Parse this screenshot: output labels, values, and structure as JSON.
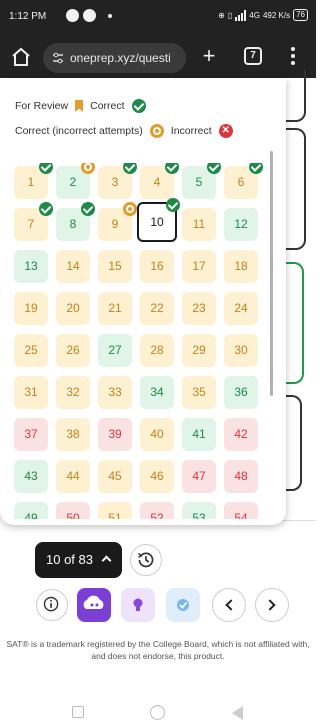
{
  "status_bar": {
    "time": "1:12 PM",
    "network": "4G",
    "speed": "492 K/s",
    "battery": "76"
  },
  "browser": {
    "url": "oneprep.xyz/questi",
    "tab_count": "7"
  },
  "legend": {
    "for_review": "For Review",
    "correct": "Correct",
    "correct_incorrect_attempts": "Correct (incorrect attempts)",
    "incorrect": "Incorrect"
  },
  "colors": {
    "review": "#c2831b",
    "correct": "#1e8a47",
    "incorrect": "#d9363e",
    "ai_button": "#7c3fd6"
  },
  "questions": [
    {
      "n": "1",
      "status": "review",
      "mark": "correct"
    },
    {
      "n": "2",
      "status": "correct",
      "mark": "correct_attempts"
    },
    {
      "n": "3",
      "status": "review",
      "mark": "correct"
    },
    {
      "n": "4",
      "status": "review",
      "mark": "correct"
    },
    {
      "n": "5",
      "status": "correct",
      "mark": "correct"
    },
    {
      "n": "6",
      "status": "review",
      "mark": "correct"
    },
    {
      "n": "7",
      "status": "review",
      "mark": "correct"
    },
    {
      "n": "8",
      "status": "correct",
      "mark": "correct"
    },
    {
      "n": "9",
      "status": "review",
      "mark": "correct_attempts"
    },
    {
      "n": "10",
      "status": "current",
      "mark": "correct"
    },
    {
      "n": "11",
      "status": "review",
      "mark": ""
    },
    {
      "n": "12",
      "status": "correct",
      "mark": ""
    },
    {
      "n": "13",
      "status": "correct",
      "mark": ""
    },
    {
      "n": "14",
      "status": "review",
      "mark": ""
    },
    {
      "n": "15",
      "status": "review",
      "mark": ""
    },
    {
      "n": "16",
      "status": "review",
      "mark": ""
    },
    {
      "n": "17",
      "status": "review",
      "mark": ""
    },
    {
      "n": "18",
      "status": "review",
      "mark": ""
    },
    {
      "n": "19",
      "status": "review",
      "mark": ""
    },
    {
      "n": "20",
      "status": "review",
      "mark": ""
    },
    {
      "n": "21",
      "status": "review",
      "mark": ""
    },
    {
      "n": "22",
      "status": "review",
      "mark": ""
    },
    {
      "n": "23",
      "status": "review",
      "mark": ""
    },
    {
      "n": "24",
      "status": "review",
      "mark": ""
    },
    {
      "n": "25",
      "status": "review",
      "mark": ""
    },
    {
      "n": "26",
      "status": "review",
      "mark": ""
    },
    {
      "n": "27",
      "status": "correct",
      "mark": ""
    },
    {
      "n": "28",
      "status": "review",
      "mark": ""
    },
    {
      "n": "29",
      "status": "review",
      "mark": ""
    },
    {
      "n": "30",
      "status": "review",
      "mark": ""
    },
    {
      "n": "31",
      "status": "review",
      "mark": ""
    },
    {
      "n": "32",
      "status": "review",
      "mark": ""
    },
    {
      "n": "33",
      "status": "review",
      "mark": ""
    },
    {
      "n": "34",
      "status": "correct",
      "mark": ""
    },
    {
      "n": "35",
      "status": "review",
      "mark": ""
    },
    {
      "n": "36",
      "status": "correct",
      "mark": ""
    },
    {
      "n": "37",
      "status": "incorrect",
      "mark": ""
    },
    {
      "n": "38",
      "status": "review",
      "mark": ""
    },
    {
      "n": "39",
      "status": "incorrect",
      "mark": ""
    },
    {
      "n": "40",
      "status": "review",
      "mark": ""
    },
    {
      "n": "41",
      "status": "correct",
      "mark": ""
    },
    {
      "n": "42",
      "status": "incorrect",
      "mark": ""
    },
    {
      "n": "43",
      "status": "correct",
      "mark": ""
    },
    {
      "n": "44",
      "status": "review",
      "mark": ""
    },
    {
      "n": "45",
      "status": "review",
      "mark": ""
    },
    {
      "n": "46",
      "status": "review",
      "mark": ""
    },
    {
      "n": "47",
      "status": "incorrect",
      "mark": ""
    },
    {
      "n": "48",
      "status": "incorrect",
      "mark": ""
    },
    {
      "n": "49",
      "status": "correct",
      "mark": ""
    },
    {
      "n": "50",
      "status": "incorrect",
      "mark": ""
    },
    {
      "n": "51",
      "status": "review",
      "mark": ""
    },
    {
      "n": "52",
      "status": "incorrect",
      "mark": ""
    },
    {
      "n": "53",
      "status": "correct",
      "mark": ""
    },
    {
      "n": "54",
      "status": "incorrect",
      "mark": ""
    }
  ],
  "navigator": {
    "position_label": "10 of 83"
  },
  "toolbar": {
    "icons": [
      "info-icon",
      "ai-assistant-icon",
      "hint-lightbulb-icon",
      "check-answer-icon",
      "previous-icon",
      "next-icon"
    ]
  },
  "disclaimer": "SAT® is a trademark registered by the College Board, which is not affiliated with, and does not endorse, this product."
}
